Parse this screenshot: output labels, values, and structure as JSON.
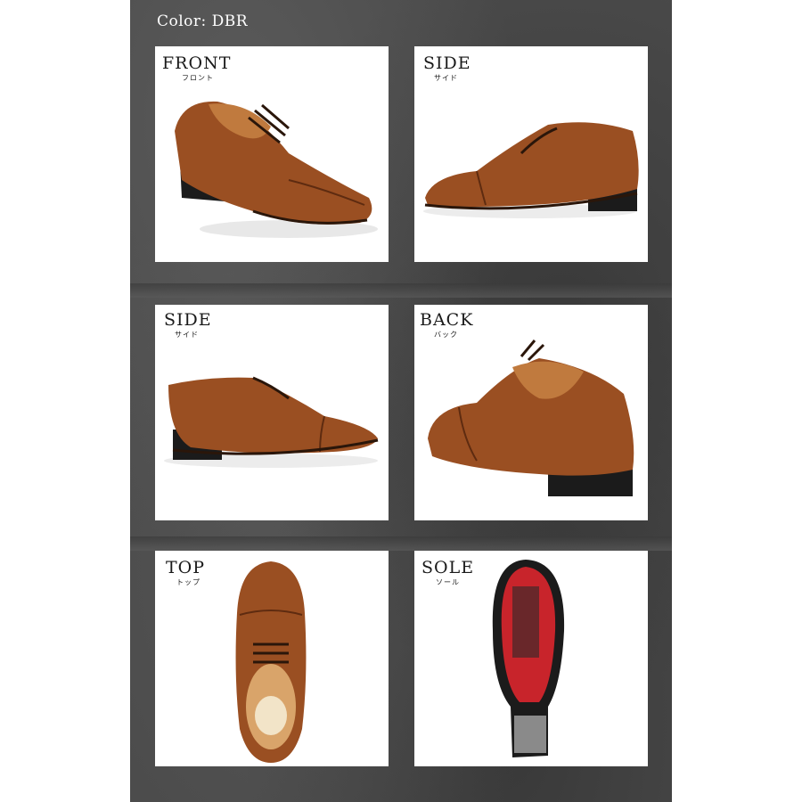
{
  "header": {
    "color_label": "Color: DBR"
  },
  "panels": [
    {
      "title": "FRONT",
      "subtitle": "フロント"
    },
    {
      "title": "SIDE",
      "subtitle": "サイド"
    },
    {
      "title": "SIDE",
      "subtitle": "サイド"
    },
    {
      "title": "BACK",
      "subtitle": "バック"
    },
    {
      "title": "TOP",
      "subtitle": "トップ"
    },
    {
      "title": "SOLE",
      "subtitle": "ソール"
    }
  ],
  "colors": {
    "leather": "#9a4f22",
    "leather_dark": "#5e2b10",
    "heel": "#1b1b1b",
    "sole_red": "#c8242b",
    "background_stone": "#4a4a4a"
  }
}
